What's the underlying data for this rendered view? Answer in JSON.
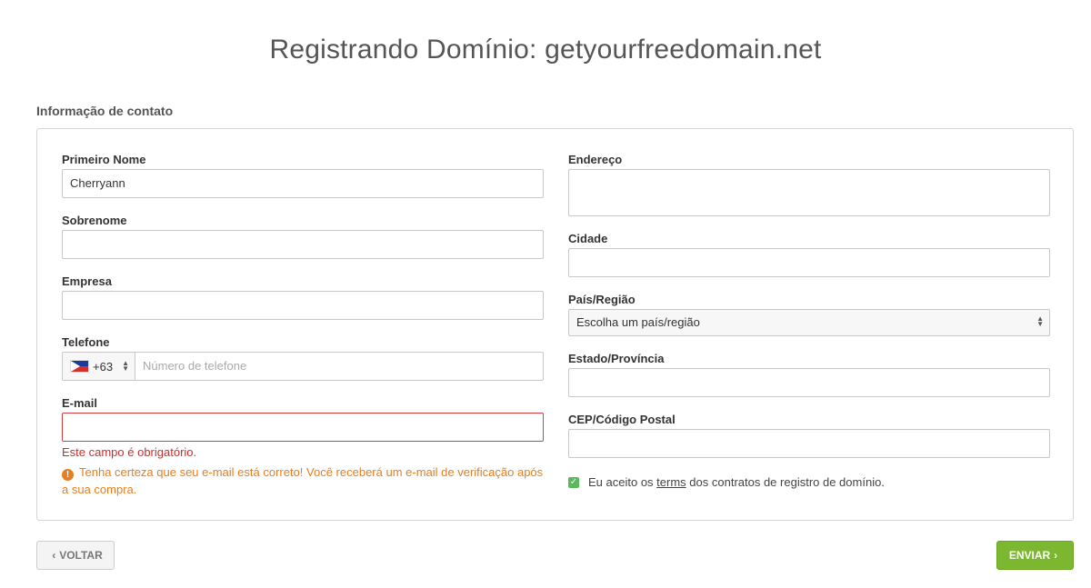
{
  "page": {
    "title": "Registrando Domínio: getyourfreedomain.net",
    "section_title": "Informação de contato"
  },
  "form": {
    "first_name": {
      "label": "Primeiro Nome",
      "value": "Cherryann"
    },
    "last_name": {
      "label": "Sobrenome",
      "value": ""
    },
    "company": {
      "label": "Empresa",
      "value": ""
    },
    "phone": {
      "label": "Telefone",
      "country_code": "+63",
      "placeholder": "Número de telefone",
      "value": ""
    },
    "email": {
      "label": "E-mail",
      "value": "",
      "error": "Este campo é obrigatório.",
      "warning": "Tenha certeza que seu e-mail está correto! Você receberá um e-mail de verificação após a sua compra."
    },
    "address": {
      "label": "Endereço",
      "value": ""
    },
    "city": {
      "label": "Cidade",
      "value": ""
    },
    "country": {
      "label": "País/Região",
      "selected": "Escolha um país/região"
    },
    "state": {
      "label": "Estado/Província",
      "value": ""
    },
    "postal": {
      "label": "CEP/Código Postal",
      "value": ""
    },
    "terms": {
      "prefix": "Eu aceito os",
      "link": "terms",
      "suffix": "dos contratos de registro de domínio.",
      "checked": true
    }
  },
  "actions": {
    "back_label": "VOLTAR",
    "submit_label": "ENVIAR"
  },
  "colors": {
    "accent_green": "#7cb82f",
    "error_red": "#c9302c",
    "warning_orange": "#e67e22"
  },
  "icons": {
    "back": "chevron-left-icon",
    "send": "chevron-right-icon",
    "warning": "exclamation-circle-icon",
    "checkbox": "check-icon",
    "flag": "philippines-flag-icon"
  }
}
